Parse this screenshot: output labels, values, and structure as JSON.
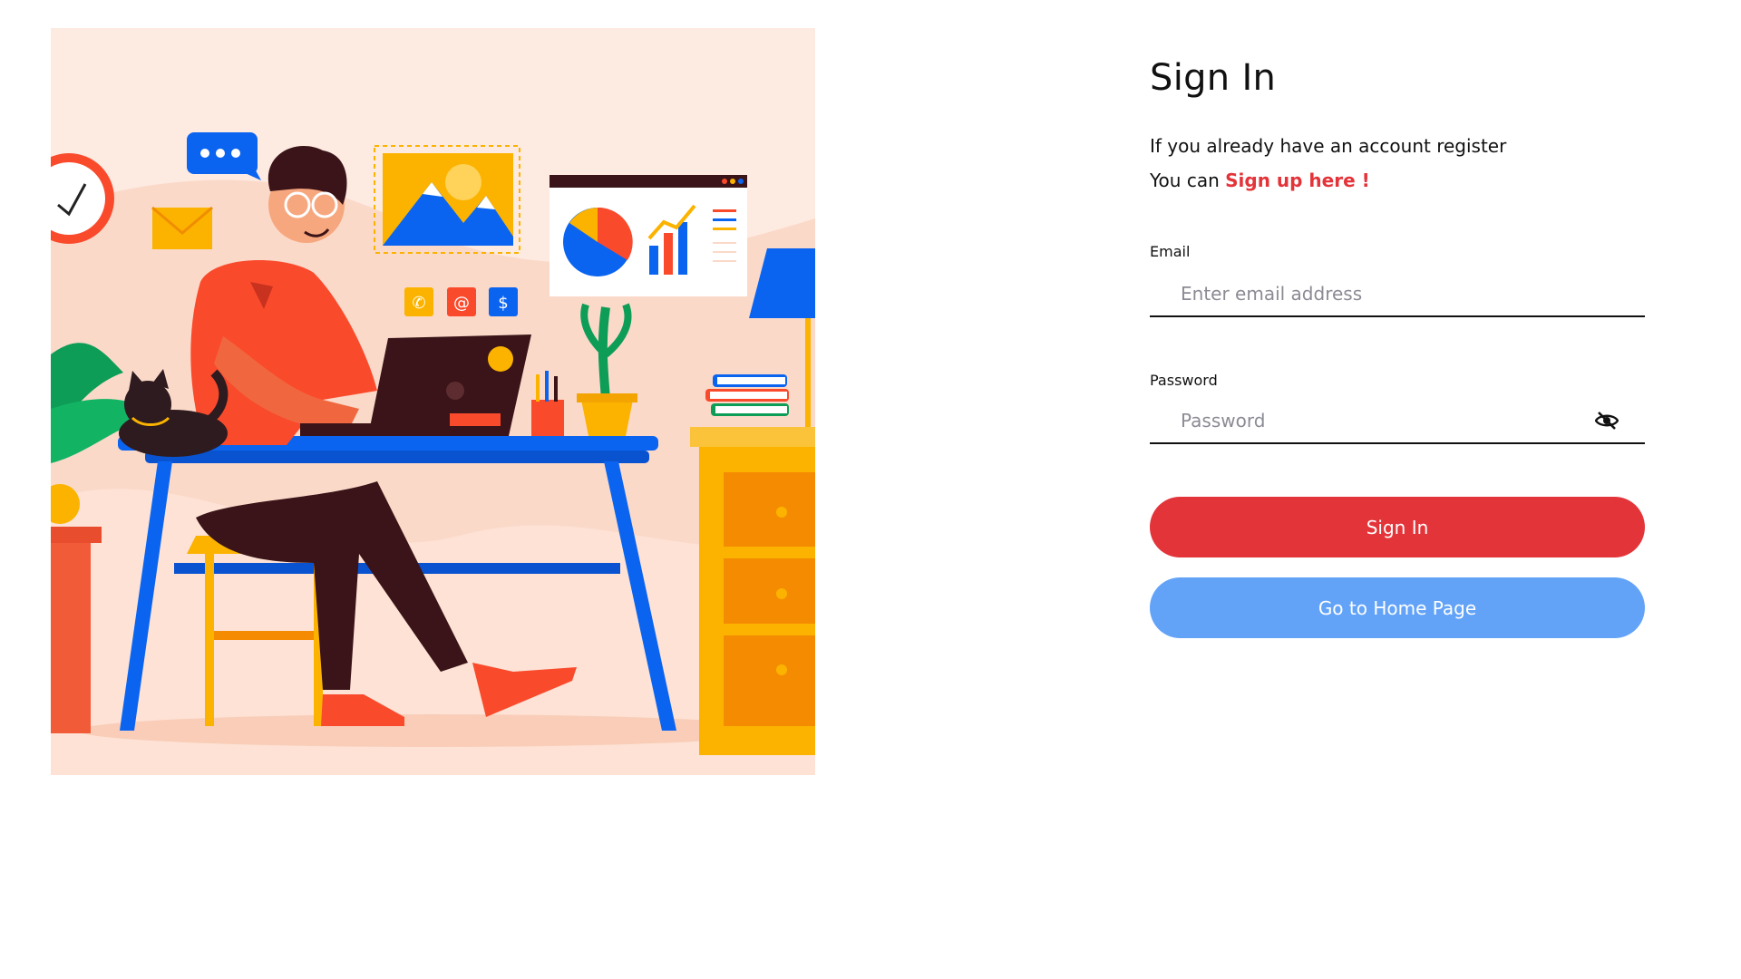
{
  "illustration": {
    "alt": "Person working at a desk with laptop",
    "palette": {
      "background": "#fdeae1",
      "primary_red": "#fa4a2c",
      "blue": "#0a64f0",
      "yellow": "#fbb300",
      "dark": "#3a1418"
    }
  },
  "form": {
    "title": "Sign In",
    "subtitle": "If you already have an account register",
    "subtitle2_prefix": "You can ",
    "signup_link": "Sign up here !",
    "email": {
      "label": "Email",
      "placeholder": "Enter email address",
      "value": ""
    },
    "password": {
      "label": "Password",
      "placeholder": "Password",
      "value": "",
      "toggle_icon": "eye-slash-icon"
    },
    "signin_button": "Sign In",
    "home_button": "Go to Home Page"
  },
  "colors": {
    "accent_red": "#e3343a",
    "accent_blue": "#62a3f8",
    "text": "#111111",
    "placeholder": "#8b8b95"
  }
}
